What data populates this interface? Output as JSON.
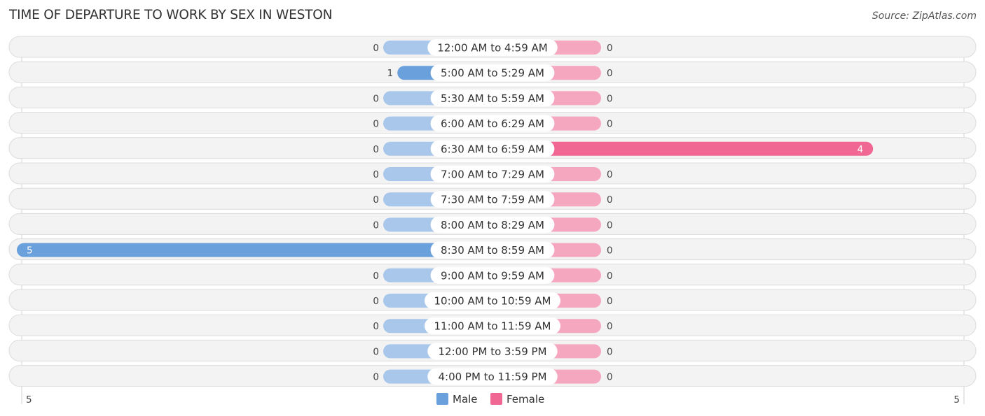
{
  "header": {
    "title": "TIME OF DEPARTURE TO WORK BY SEX IN WESTON",
    "source": "Source: ZipAtlas.com"
  },
  "chart_data": {
    "type": "bar",
    "orientation": "horizontal-diverging",
    "title": "TIME OF DEPARTURE TO WORK BY SEX IN WESTON",
    "categories": [
      "12:00 AM to 4:59 AM",
      "5:00 AM to 5:29 AM",
      "5:30 AM to 5:59 AM",
      "6:00 AM to 6:29 AM",
      "6:30 AM to 6:59 AM",
      "7:00 AM to 7:29 AM",
      "7:30 AM to 7:59 AM",
      "8:00 AM to 8:29 AM",
      "8:30 AM to 8:59 AM",
      "9:00 AM to 9:59 AM",
      "10:00 AM to 10:59 AM",
      "11:00 AM to 11:59 AM",
      "12:00 PM to 3:59 PM",
      "4:00 PM to 11:59 PM"
    ],
    "series": [
      {
        "name": "Male",
        "color": "#6aa0dc",
        "color_light": "#a9c7ea",
        "values": [
          0,
          1,
          0,
          0,
          0,
          0,
          0,
          0,
          5,
          0,
          0,
          0,
          0,
          0
        ]
      },
      {
        "name": "Female",
        "color": "#f06793",
        "color_light": "#f5a7c0",
        "values": [
          0,
          0,
          0,
          0,
          4,
          0,
          0,
          0,
          0,
          0,
          0,
          0,
          0,
          0
        ]
      }
    ],
    "axis": {
      "min_label": "5",
      "max_label": "5",
      "range": [
        -5,
        5
      ]
    },
    "legend": {
      "position": "bottom-center",
      "entries": [
        "Male",
        "Female"
      ]
    },
    "grid": false
  }
}
